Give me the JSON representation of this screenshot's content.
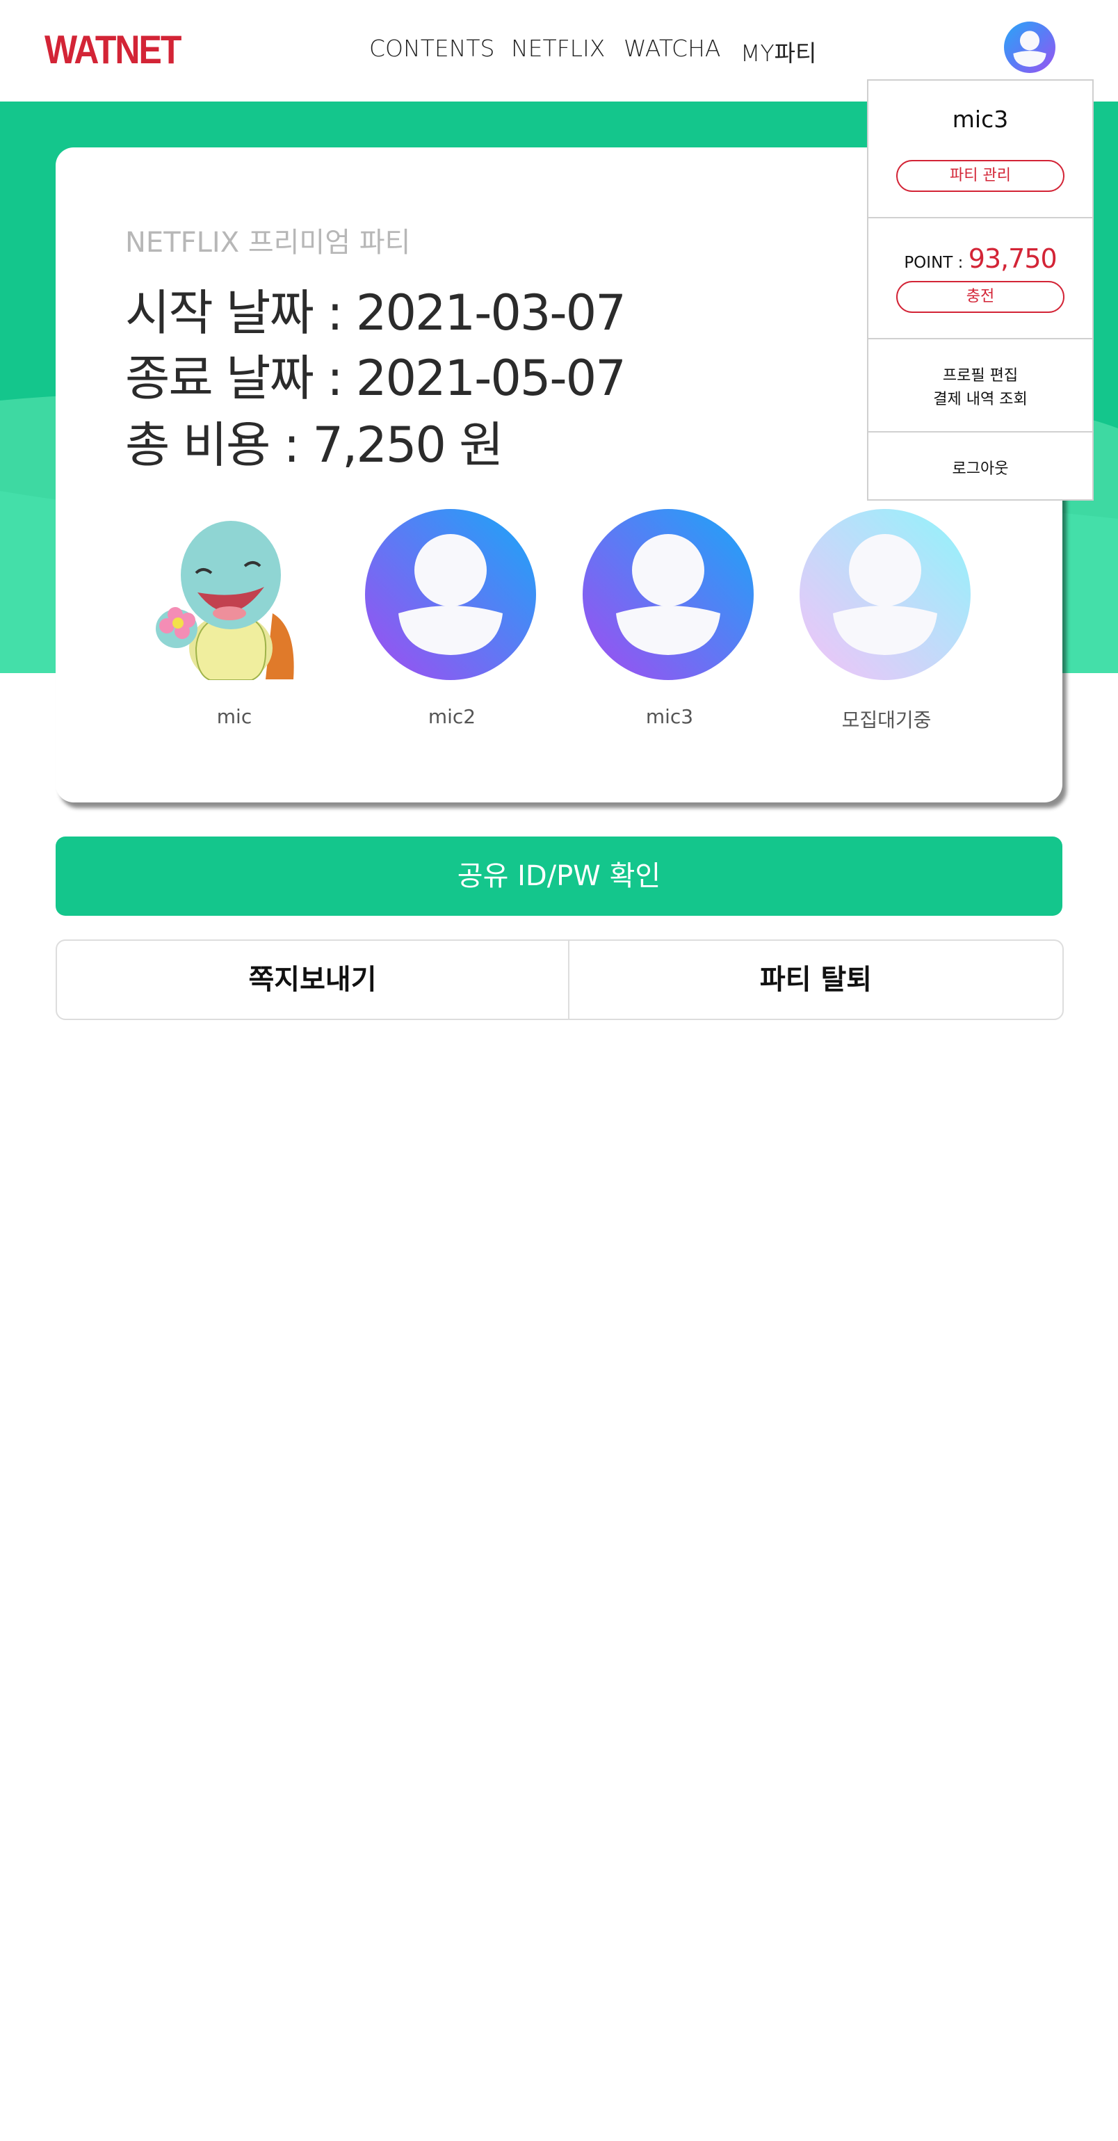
{
  "header": {
    "logo": "WATNET",
    "nav": [
      "CONTENTS",
      "NETFLIX",
      "WATCHA",
      "MY파티"
    ]
  },
  "party": {
    "type": "NETFLIX 프리미엄 파티",
    "start_line": "시작 날짜 : 2021-03-07",
    "end_line": "종료 날짜 : 2021-05-07",
    "cost_line": "총 비용 : 7,250 원",
    "members": [
      {
        "name": "mic",
        "avatar": "squirtle-avatar"
      },
      {
        "name": "mic2",
        "avatar": "default-user-avatar"
      },
      {
        "name": "mic3",
        "avatar": "default-user-avatar"
      },
      {
        "name": "모집대기중",
        "avatar": "empty-slot-avatar"
      }
    ]
  },
  "buttons": {
    "share": "공유 ID/PW 확인",
    "message": "쪽지보내기",
    "leave": "파티 탈퇴"
  },
  "dropdown": {
    "username": "mic3",
    "party_manage": "파티 관리",
    "point_label": "POINT : ",
    "point_value": "93,750",
    "charge": "충전",
    "profile_edit": "프로필 편집",
    "payment_history": "결제 내역 조회",
    "logout": "로그아웃"
  },
  "colors": {
    "brand_red": "#d32436",
    "brand_green": "#14c68c",
    "avatar_gradient": [
      "#2aa6f7",
      "#9b53f0"
    ],
    "empty_gradient": [
      "#8ff4fb",
      "#f0c4f8"
    ]
  }
}
